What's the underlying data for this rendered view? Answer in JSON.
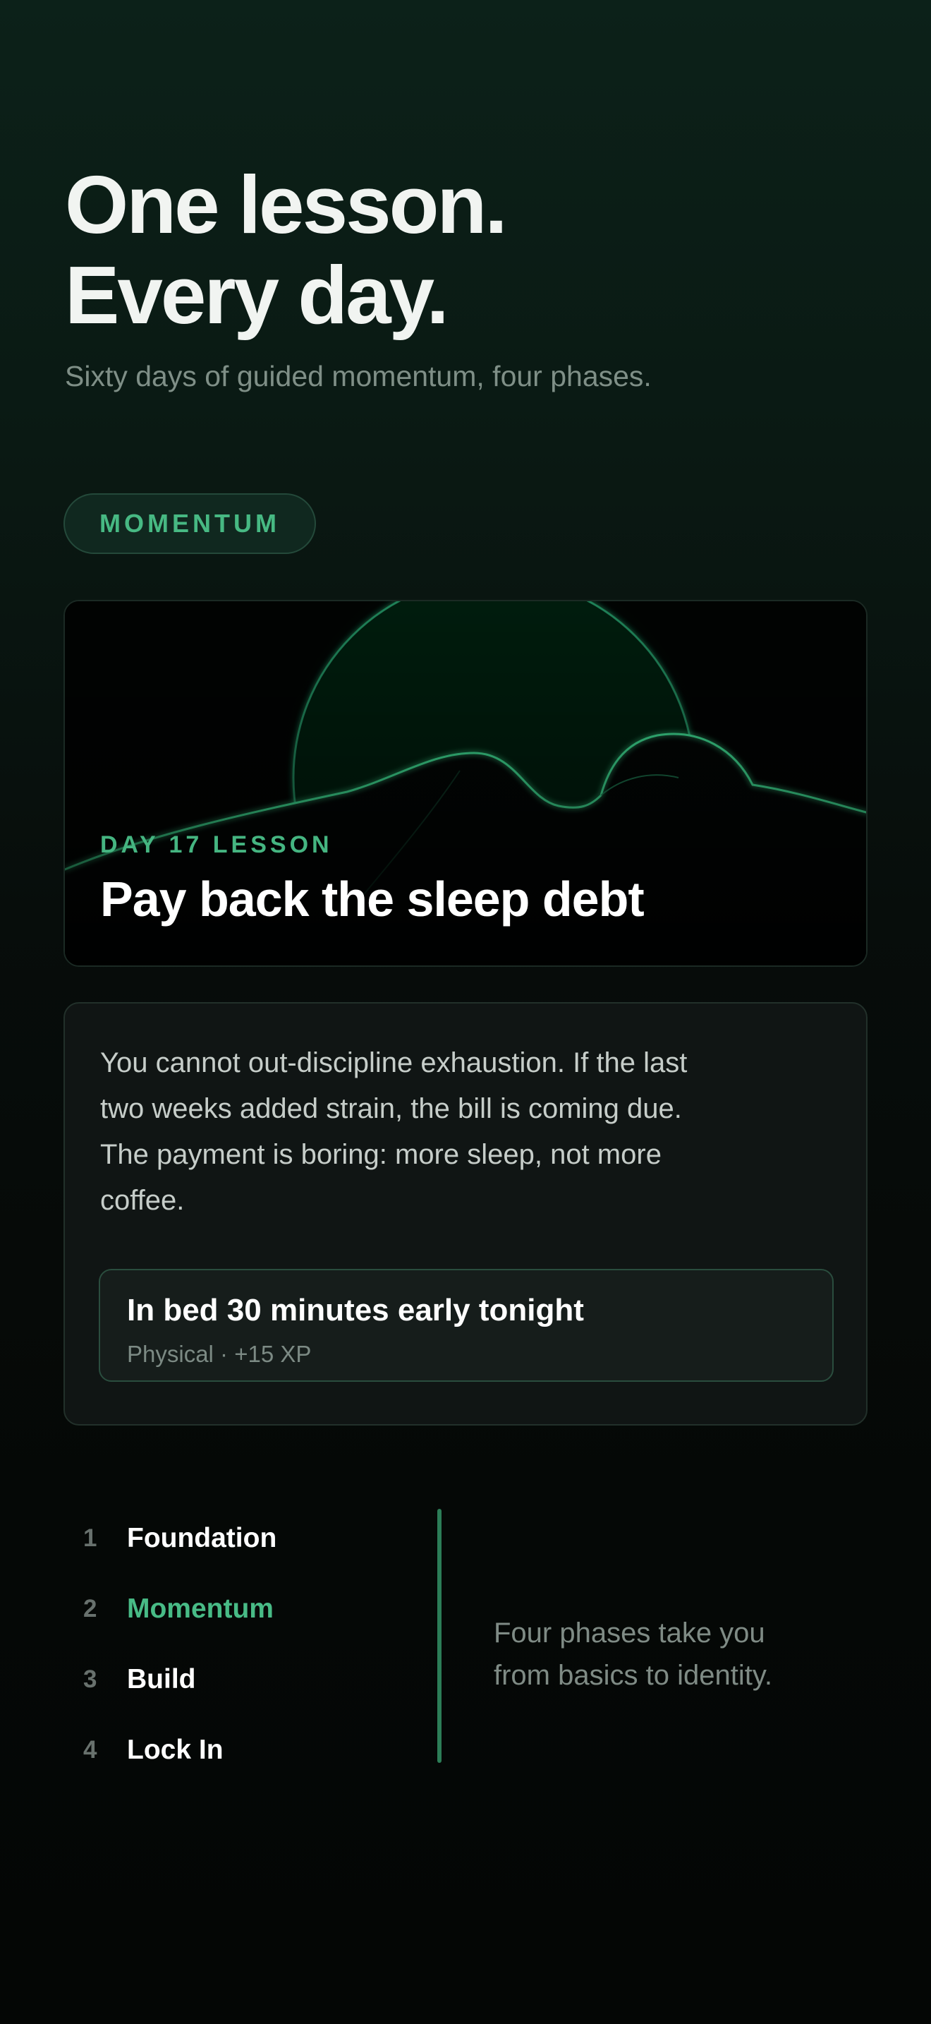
{
  "headline": {
    "line1": "One lesson.",
    "line2": "Every day."
  },
  "subheadline": "Sixty days of guided momentum, four phases.",
  "current_phase_badge": "MOMENTUM",
  "lesson": {
    "day_label": "DAY 17 LESSON",
    "title": "Pay back the sleep debt",
    "body": "You cannot out-discipline exhaustion. If the last two weeks added strain, the bill is coming due. The payment is boring: more sleep, not more coffee.",
    "task": {
      "title": "In bed 30 minutes early tonight",
      "meta": "Physical · +15 XP"
    }
  },
  "phases": [
    {
      "number": "1",
      "name": "Foundation",
      "active": false
    },
    {
      "number": "2",
      "name": "Momentum",
      "active": true
    },
    {
      "number": "3",
      "name": "Build",
      "active": false
    },
    {
      "number": "4",
      "name": "Lock In",
      "active": false
    }
  ],
  "phases_note": "Four phases take you from basics to identity.",
  "colors": {
    "accent": "#48bb86",
    "background_top": "#0c2119",
    "background_bottom": "#040605",
    "card": "#101514"
  }
}
